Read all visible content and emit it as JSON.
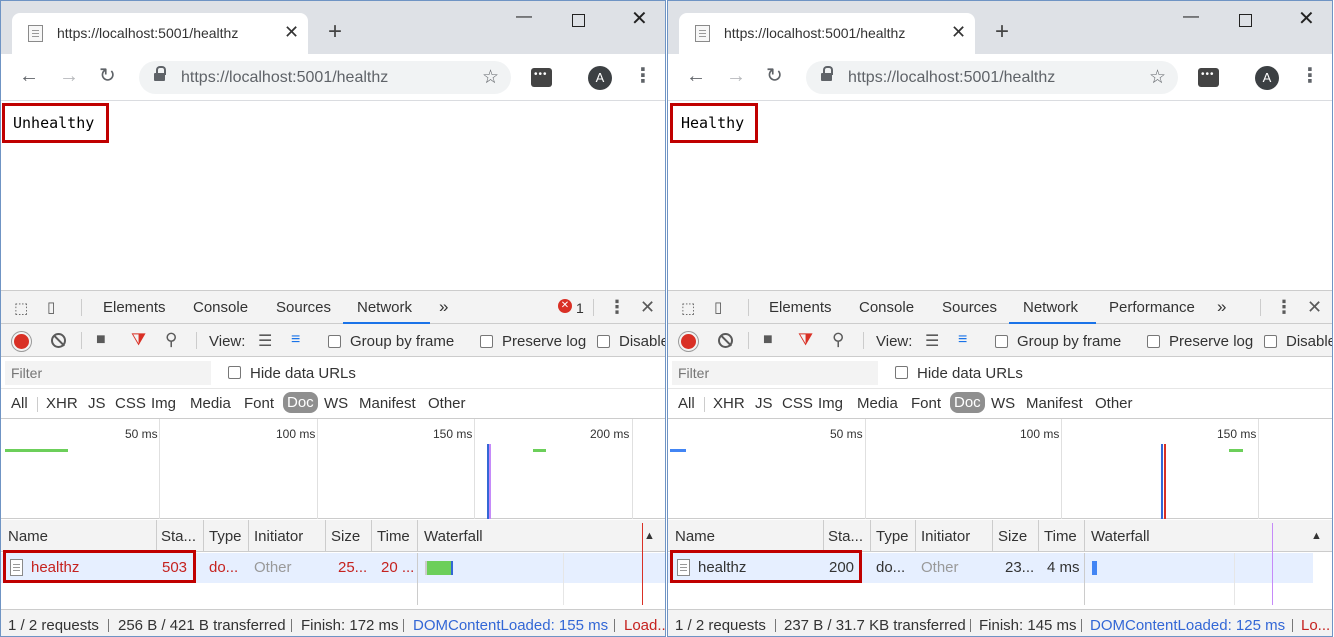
{
  "windows": [
    {
      "tab_title": "https://localhost:5001/healthz",
      "url": "https://localhost:5001/healthz",
      "avatar_letter": "A",
      "page_text": "Unhealthy",
      "devtools": {
        "panels": [
          "Elements",
          "Console",
          "Sources",
          "Network"
        ],
        "more": "»",
        "error_count": "1",
        "toolbar": {
          "view_label": "View:",
          "group_by_frame": "Group by frame",
          "preserve_log": "Preserve log",
          "disable_cache": "Disable"
        },
        "filter_placeholder": "Filter",
        "hide_data_urls": "Hide data URLs",
        "types": [
          "All",
          "XHR",
          "JS",
          "CSS",
          "Img",
          "Media",
          "Font",
          "Doc",
          "WS",
          "Manifest",
          "Other"
        ],
        "active_type": "Doc",
        "overview_ticks": [
          "50 ms",
          "100 ms",
          "150 ms",
          "200 ms"
        ],
        "columns": [
          "Name",
          "Sta...",
          "Type",
          "Initiator",
          "Size",
          "Time",
          "Waterfall"
        ],
        "row": {
          "name": "healthz",
          "status": "503",
          "type": "do...",
          "initiator": "Other",
          "size": "25...",
          "time": "20 ..."
        },
        "status_bar": {
          "requests": "1 / 2 requests",
          "transferred": "256 B / 421 B transferred",
          "finish": "Finish: 172 ms",
          "dom_content_loaded": "DOMContentLoaded: 155 ms",
          "load": "Load..."
        }
      }
    },
    {
      "tab_title": "https://localhost:5001/healthz",
      "url": "https://localhost:5001/healthz",
      "avatar_letter": "A",
      "page_text": "Healthy",
      "devtools": {
        "panels": [
          "Elements",
          "Console",
          "Sources",
          "Network",
          "Performance"
        ],
        "more": "»",
        "toolbar": {
          "view_label": "View:",
          "group_by_frame": "Group by frame",
          "preserve_log": "Preserve log",
          "disable_cache": "Disable"
        },
        "filter_placeholder": "Filter",
        "hide_data_urls": "Hide data URLs",
        "types": [
          "All",
          "XHR",
          "JS",
          "CSS",
          "Img",
          "Media",
          "Font",
          "Doc",
          "WS",
          "Manifest",
          "Other"
        ],
        "active_type": "Doc",
        "overview_ticks": [
          "50 ms",
          "100 ms",
          "150 ms"
        ],
        "columns": [
          "Name",
          "Sta...",
          "Type",
          "Initiator",
          "Size",
          "Time",
          "Waterfall"
        ],
        "row": {
          "name": "healthz",
          "status": "200",
          "type": "do...",
          "initiator": "Other",
          "size": "23...",
          "time": "4 ms"
        },
        "status_bar": {
          "requests": "1 / 2 requests",
          "transferred": "237 B / 31.7 KB transferred",
          "finish": "Finish: 145 ms",
          "dom_content_loaded": "DOMContentLoaded: 125 ms",
          "load": "Lo..."
        }
      }
    }
  ],
  "colors": {
    "error_status": "#c5221f",
    "ok_status": "#333333",
    "highlight_box": "#c00000",
    "dom_content_loaded": "#3367d6",
    "record_button": "#d93025"
  }
}
